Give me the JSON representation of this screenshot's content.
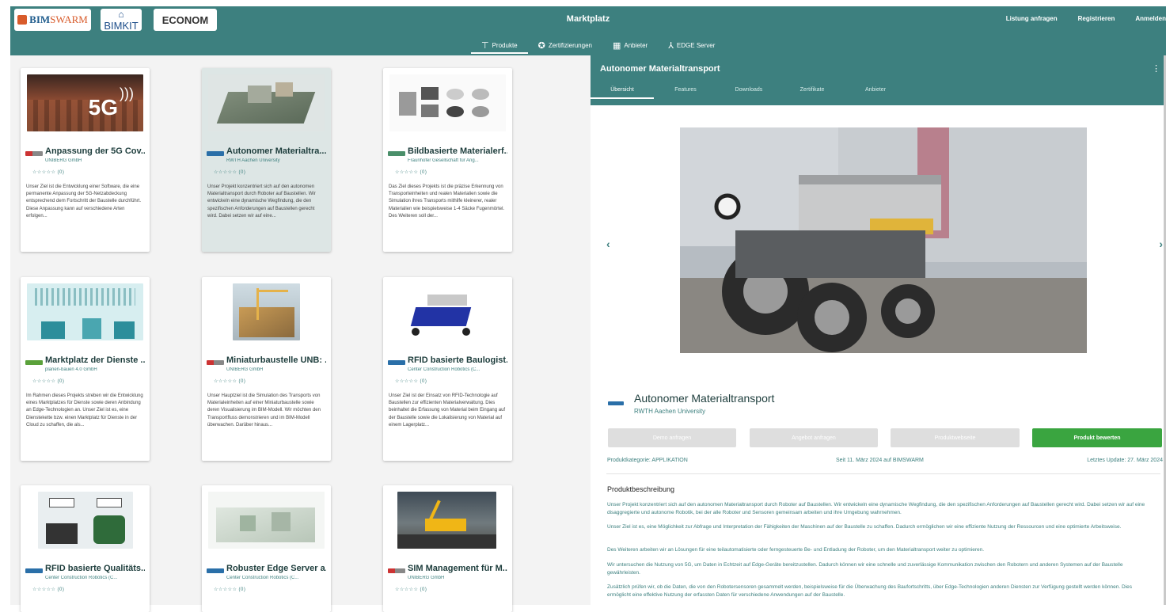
{
  "header": {
    "logos": {
      "bimswarm_a": "BIM",
      "bimswarm_b": "SWARM",
      "bimkit": "BIMKIT",
      "econom": "ECONOM"
    },
    "title": "Marktplatz",
    "actions": [
      "Listung anfragen",
      "Registrieren",
      "Anmelden"
    ],
    "nav": [
      {
        "label": "Produkte",
        "icon": "sitemap-icon"
      },
      {
        "label": "Zertifizierungen",
        "icon": "certificate-icon"
      },
      {
        "label": "Anbieter",
        "icon": "building-icon"
      },
      {
        "label": "EDGE Server",
        "icon": "network-icon"
      }
    ]
  },
  "cards": [
    {
      "title": "Anpassung der 5G Cov...",
      "org": "UNIBERG GmbH",
      "stars": "☆☆☆☆☆ (0)",
      "desc": "Unser Ziel ist die Entwicklung einer Software, die eine permanente Anpassung der 5G-Netzabdeckung entsprechend dem Fortschritt der Baustelle durchführt. Diese Anpassung kann auf verschiedene Arten erfolgen...",
      "thumb_text": "5G"
    },
    {
      "title": "Autonomer Materialtra...",
      "org": "RWTH Aachen University",
      "stars": "☆☆☆☆☆ (0)",
      "desc": "Unser Projekt konzentriert sich auf den autonomen Materialtransport durch Roboter auf Baustellen. Wir entwickeln eine dynamische Wegfindung, die den spezifischen Anforderungen auf Baustellen gerecht wird. Dabei setzen wir auf eine...",
      "thumb_text": ""
    },
    {
      "title": "Bildbasierte Materialerf...",
      "org": "Fraunhofer Gesellschaft für Ang...",
      "stars": "☆☆☆☆☆ (0)",
      "desc": "Das Ziel dieses Projekts ist die präzise Erkennung von Transporteinheiten und realen Materialien sowie die Simulation ihres Transports mithilfe kleinerer, realer Materialien wie beispielsweise 1-4 Säcke Fugenmörtel. Des Weiteren soll der...",
      "thumb_text": ""
    },
    {
      "title": "Marktplatz der Dienste ...",
      "org": "planen-bauen 4.0 GmbH",
      "stars": "☆☆☆☆☆ (0)",
      "desc": "Im Rahmen dieses Projekts streben wir die Entwicklung eines Marktplatzes für Dienste sowie deren Anbindung an Edge-Technologien an. Unser Ziel ist es, eine Dienstekette bzw. einen Marktplatz für Dienste in der Cloud zu schaffen, die als...",
      "thumb_text": ""
    },
    {
      "title": "Miniaturbaustelle UNB: ...",
      "org": "UNIBERG GmbH",
      "stars": "☆☆☆☆☆ (0)",
      "desc": "Unser Hauptziel ist die Simulation des Transports von Materialeinheiten auf einer Miniaturbaustelle sowie deren Visualisierung im BIM-Modell. Wir möchten den Transportfluss demonstrieren und im BIM-Modell überwachen. Darüber hinaus...",
      "thumb_text": ""
    },
    {
      "title": "RFID basierte Baulogist...",
      "org": "Center Construction Robotics (C...",
      "stars": "☆☆☆☆☆ (0)",
      "desc": "Unser Ziel ist der Einsatz von RFID-Technologie auf Baustellen zur effizienten Materialverwaltung. Dies beinhaltet die Erfassung von Material beim Eingang auf der Baustelle sowie die Lokalisierung von Material auf einem Lagerplatz...",
      "thumb_text": ""
    },
    {
      "title": "RFID basierte Qualitäts...",
      "org": "Center Construction Robotics (C...",
      "stars": "☆☆☆☆☆ (0)",
      "desc": "",
      "thumb_text": ""
    },
    {
      "title": "Robuster Edge Server a...",
      "org": "Center Construction Robotics (C...",
      "stars": "☆☆☆☆☆ (0)",
      "desc": "",
      "thumb_text": ""
    },
    {
      "title": "SIM Management für M...",
      "org": "UNIBERG GmbH",
      "stars": "☆☆☆☆☆ (0)",
      "desc": "",
      "thumb_text": ""
    }
  ],
  "detail": {
    "title": "Autonomer Materialtransport",
    "tabs": [
      "Übersicht",
      "Features",
      "Downloads",
      "Zertifikate",
      "Anbieter"
    ],
    "product_name": "Autonomer Materialtransport",
    "product_org": "RWTH Aachen University",
    "buttons": [
      "Demo anfragen",
      "Angebot anfragen",
      "Produktwebseite",
      "Produkt bewerten"
    ],
    "category": "Produktkategorie: APPLIKATION",
    "since": "Seit 11. März 2024 auf BIMSWARM",
    "updated": "Letztes Update: 27. März 2024",
    "section_title": "Produktbeschreibung",
    "paragraphs": [
      "Unser Projekt konzentriert sich auf den autonomen Materialtransport durch Roboter auf Baustellen. Wir entwickeln eine dynamische Wegfindung, die den spezifischen Anforderungen auf Baustellen gerecht wird. Dabei setzen wir auf eine disaggregierte und autonome Robotik, bei der alle Roboter und Sensoren gemeinsam arbeiten und ihre Umgebung wahrnehmen.",
      "Unser Ziel ist es, eine Möglichkeit zur Abfrage und Interpretation der Fähigkeiten der Maschinen auf der Baustelle zu schaffen. Dadurch ermöglichen wir eine effiziente Nutzung der Ressourcen und eine optimierte Arbeitsweise.",
      "Des Weiteren arbeiten wir an Lösungen für eine teilautomatisierte oder ferngesteuerte Be- und Entladung der Roboter, um den Materialtransport weiter zu optimieren.",
      "Wir untersuchen die Nutzung von 5G, um Daten in Echtzeit auf Edge-Geräte bereitzustellen. Dadurch können wir eine schnelle und zuverlässige Kommunikation zwischen den Robotern und anderen Systemen auf der Baustelle gewährleisten.",
      "Zusätzlich prüfen wir, ob die Daten, die von den Robotersensoren gesammelt werden, beispielsweise für die Überwachung des Baufortschritts, über Edge-Technologien anderen Diensten zur Verfügung gestellt werden können. Dies ermöglicht eine effektive Nutzung der erfassten Daten für verschiedene Anwendungen auf der Baustelle."
    ]
  },
  "colors": {
    "teal": "#3d807f",
    "green": "#3aa540"
  }
}
